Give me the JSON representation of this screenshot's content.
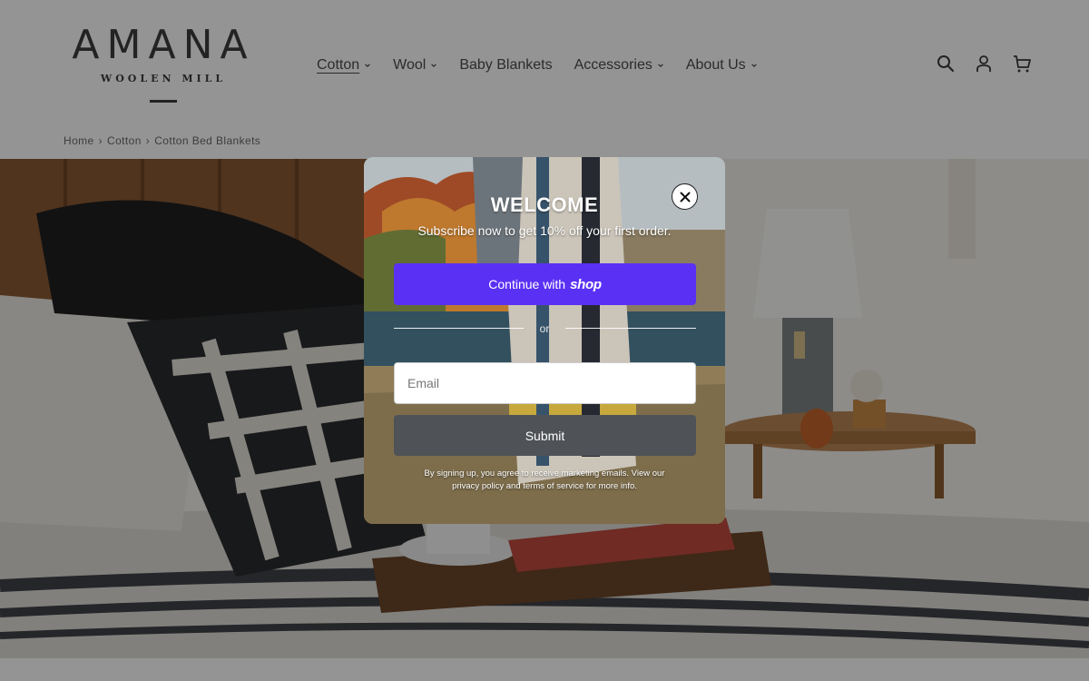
{
  "brand": {
    "name": "AMANA",
    "tagline": "WOOLEN MILL"
  },
  "nav": {
    "items": [
      {
        "label": "Cotton",
        "has_dropdown": true,
        "active": true
      },
      {
        "label": "Wool",
        "has_dropdown": true,
        "active": false
      },
      {
        "label": "Baby Blankets",
        "has_dropdown": false,
        "active": false
      },
      {
        "label": "Accessories",
        "has_dropdown": true,
        "active": false
      },
      {
        "label": "About Us",
        "has_dropdown": true,
        "active": false
      }
    ]
  },
  "header_icons": [
    "search-icon",
    "account-icon",
    "cart-icon"
  ],
  "breadcrumb": {
    "items": [
      "Home",
      "Cotton",
      "Cotton Bed Blankets"
    ],
    "separator": "›"
  },
  "popup": {
    "title": "WELCOME",
    "subtitle": "Subscribe now to get 10% off your first order.",
    "shop_button": {
      "prefix": "Continue with",
      "brand": "shop"
    },
    "divider_text": "or",
    "email_placeholder": "Email",
    "submit_label": "Submit",
    "legal_text": "By signing up, you agree to receive marketing emails. View our privacy policy and terms of service for more info."
  },
  "colors": {
    "shop_purple": "#5a31f4",
    "submit_gray": "#4f5257",
    "overlay": "rgba(0,0,0,0.42)",
    "text_dark": "#3d3d3d"
  }
}
